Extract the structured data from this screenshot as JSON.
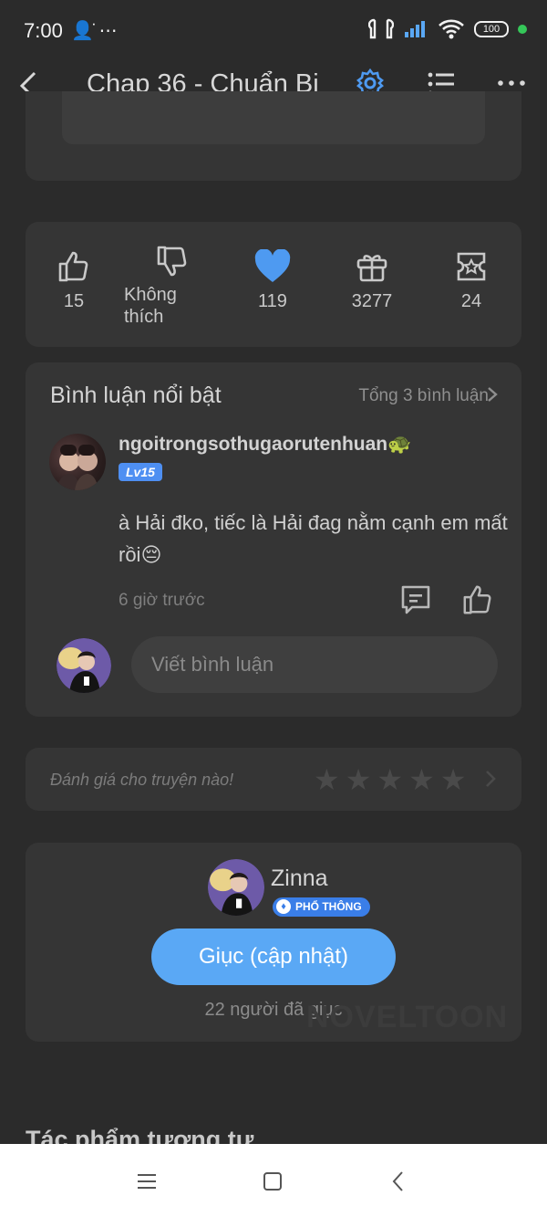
{
  "status_bar": {
    "time": "7:00",
    "battery": "100"
  },
  "top_bar": {
    "title": "Chap 36 - Chuẩn Bị"
  },
  "reactions": [
    {
      "label": "15"
    },
    {
      "label": "Không thích"
    },
    {
      "label": "119"
    },
    {
      "label": "3277"
    },
    {
      "label": "24"
    }
  ],
  "comments": {
    "header": "Bình luận nổi bật",
    "total": "Tổng 3 bình luận",
    "item": {
      "username": "ngoitrongsothugaorutenhuan🐢",
      "level": "Lv15",
      "text": "à Hải đko, tiếc là Hải đag nằm cạnh em mất rồi😔",
      "time": "6 giờ trước"
    },
    "write_placeholder": "Viết bình luận"
  },
  "rating": {
    "prompt": "Đánh giá cho truyện nào!"
  },
  "author": {
    "name": "Zinna",
    "badge": "PHỔ THÔNG",
    "urge_button": "Giục (cập nhật)",
    "urge_count": "22 người đã giục",
    "watermark": "NOVELTOON"
  },
  "similar_title": "Tác phẩm tương tự",
  "colors": {
    "accent": "#4e9af1",
    "background": "#2b2b2b",
    "card": "#353535"
  }
}
